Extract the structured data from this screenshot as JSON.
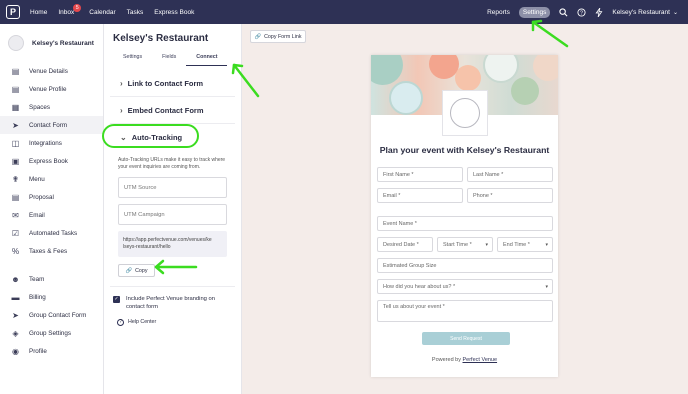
{
  "nav": {
    "logo_letter": "P",
    "links": [
      "Home",
      "Inbox",
      "Calendar",
      "Tasks",
      "Express Book"
    ],
    "inbox_badge": "5",
    "reports": "Reports",
    "settings": "Settings",
    "account": "Kelsey's Restaurant"
  },
  "sidebar": {
    "venue_name": "Kelsey's Restaurant",
    "items": [
      {
        "label": "Venue Details",
        "icon": "list-icon"
      },
      {
        "label": "Venue Profile",
        "icon": "profile-icon"
      },
      {
        "label": "Spaces",
        "icon": "grid-icon"
      },
      {
        "label": "Contact Form",
        "icon": "cursor-icon"
      },
      {
        "label": "Integrations",
        "icon": "box-icon"
      },
      {
        "label": "Express Book",
        "icon": "calendar-icon"
      },
      {
        "label": "Menu",
        "icon": "utensils-icon"
      },
      {
        "label": "Proposal",
        "icon": "document-icon"
      },
      {
        "label": "Email",
        "icon": "envelope-icon"
      },
      {
        "label": "Automated Tasks",
        "icon": "checklist-icon"
      },
      {
        "label": "Taxes & Fees",
        "icon": "percent-icon"
      }
    ],
    "items2": [
      {
        "label": "Team",
        "icon": "users-icon"
      },
      {
        "label": "Billing",
        "icon": "card-icon"
      },
      {
        "label": "Group Contact Form",
        "icon": "cursor-icon"
      },
      {
        "label": "Group Settings",
        "icon": "layers-icon"
      },
      {
        "label": "Profile",
        "icon": "user-circle-icon"
      }
    ]
  },
  "panel": {
    "title": "Kelsey's Restaurant",
    "tabs": [
      "Settings",
      "Fields",
      "Connect"
    ],
    "sections": [
      "Link to Contact Form",
      "Embed Contact Form",
      "Auto-Tracking"
    ],
    "description": "Auto-Tracking URLs make it easy to track where your event inquiries are coming from.",
    "utm_source": "UTM Source",
    "utm_campaign": "UTM Campaign",
    "url_line1": "https://app.perfectvenue.com/venues/ke",
    "url_line2": "lseys-restaurant/hello",
    "copy": "Copy",
    "branding_line1": "Include Perfect Venue branding on",
    "branding_line2": "contact form",
    "help": "Help Center"
  },
  "preview": {
    "copy_form_link": "Copy Form Link",
    "title": "Plan your event with Kelsey's Restaurant",
    "first_name": "First Name *",
    "last_name": "Last Name *",
    "email": "Email *",
    "phone": "Phone *",
    "event_name": "Event Name *",
    "desired_date": "Desired Date *",
    "start_time": "Start Time *",
    "end_time": "End Time *",
    "group_size": "Estimated Group Size",
    "hear_about": "How did you hear about us? *",
    "tell_us": "Tell us about your event *",
    "send": "Send Request",
    "powered_by": "Powered by",
    "powered_link": "Perfect Venue"
  },
  "colors": {
    "nav": "#2e3155",
    "highlight": "#3bdc20",
    "send_button": "#a9cfd6",
    "preview_bg": "#f4ece9"
  }
}
